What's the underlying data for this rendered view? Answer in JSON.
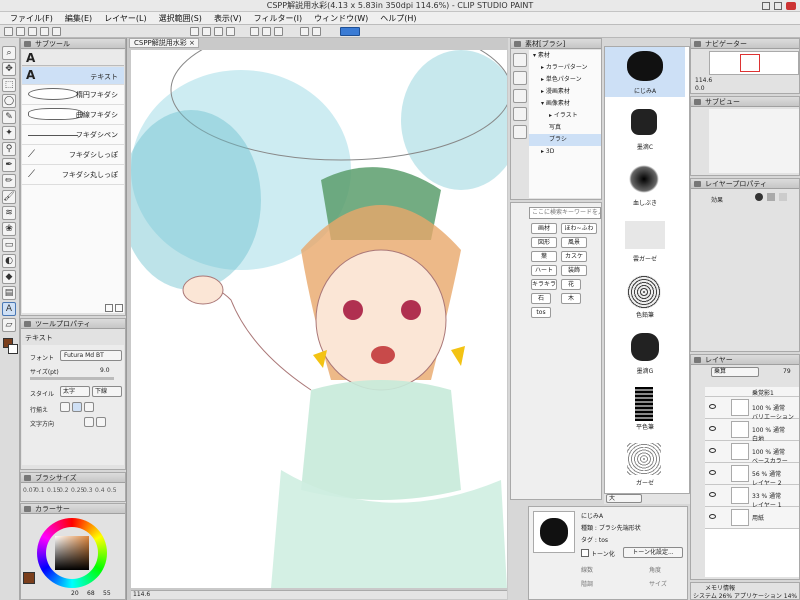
{
  "window": {
    "title": "CSPP解説用水彩(4.13 x 5.83in 350dpi 114.6%) - CLIP STUDIO PAINT"
  },
  "menu": [
    "ファイル(F)",
    "編集(E)",
    "レイヤー(L)",
    "選択範囲(S)",
    "表示(V)",
    "フィルター(I)",
    "ウィンドウ(W)",
    "ヘルプ(H)"
  ],
  "canvas": {
    "tab": "CSPP解説用水彩",
    "zoom": "114.6"
  },
  "subtool": {
    "title": "サブツール",
    "selected": "テキスト",
    "items": [
      "テキスト",
      "楕円フキダシ",
      "曲線フキダシ",
      "フキダシペン",
      "フキダシしっぽ",
      "フキダシ丸しっぽ"
    ]
  },
  "toolprop": {
    "title": "ツールプロパティ",
    "name": "テキスト",
    "font_label": "フォント",
    "font": "Futura Md BT",
    "size_label": "サイズ(pt)",
    "size": "9.0",
    "style_label": "スタイル",
    "bold": "太字",
    "underline": "下線",
    "align_label": "行揃え",
    "dir_label": "文字方向"
  },
  "brushsize": {
    "title": "ブラシサイズ",
    "values": [
      "0.07",
      "0.1",
      "0.15",
      "0.2",
      "0.25",
      "0.3",
      "0.4",
      "0.5",
      "0.6"
    ]
  },
  "color": {
    "title": "カラーサー",
    "main": "#7a3e1c",
    "sub": "#ffffff",
    "values": [
      "20",
      "68",
      "55"
    ]
  },
  "material": {
    "title": "素材[ブラシ]",
    "tree": [
      "素材",
      "カラーパターン",
      "単色パターン",
      "漫画素材",
      "画像素材",
      "イラスト",
      "写真",
      "ブラシ",
      "3D"
    ],
    "selected": "ブラシ",
    "search_placeholder": "ここに検索キーワードを入力",
    "tags": [
      "画材",
      "ほわ~ふわ",
      "図形",
      "風景",
      "葉",
      "カスケ",
      "ハート",
      "装飾",
      "キラキラ",
      "花",
      "石",
      "木",
      "tos"
    ]
  },
  "brushes": [
    "にじみA",
    "墨滴C",
    "血しぶき",
    "雲ガーゼ",
    "色鉛筆",
    "墨滴G",
    "平色筆",
    "ガーゼ"
  ],
  "brushdetail": {
    "name": "にじみA",
    "kind_label": "種類",
    "kind": "ブラシ先端形状",
    "tag_label": "タグ",
    "tag": "tos",
    "tone": "トーン化",
    "tone_btn": "トーン化設定...",
    "f1": "線数",
    "f2": "角度",
    "f3": "階調",
    "f4": "サイズ",
    "size_label": "大"
  },
  "navigator": {
    "title": "ナビゲーター",
    "zoom": "114.6",
    "rot": "0.0"
  },
  "subview": {
    "title": "サブビュー"
  },
  "layerprop": {
    "title": "レイヤープロパティ",
    "effect": "効果"
  },
  "layers": {
    "title": "レイヤー",
    "mode": "乗算",
    "opacity": "79",
    "rows": [
      {
        "name": "乗覚影1"
      },
      {
        "pct": "100 %",
        "mode": "通常",
        "name": "バリエーション"
      },
      {
        "pct": "100 %",
        "mode": "通常",
        "name": "白地"
      },
      {
        "pct": "100 %",
        "mode": "通常",
        "name": "ベースカラー"
      },
      {
        "pct": "56 %",
        "mode": "通常",
        "name": "レイヤー 2"
      },
      {
        "pct": "33 %",
        "mode": "通常",
        "name": "レイヤー 1"
      },
      {
        "name": "用紙"
      }
    ]
  },
  "memory": {
    "title": "メモリ情報",
    "system": "システム 26%",
    "app": "アプリケーション 14%"
  }
}
